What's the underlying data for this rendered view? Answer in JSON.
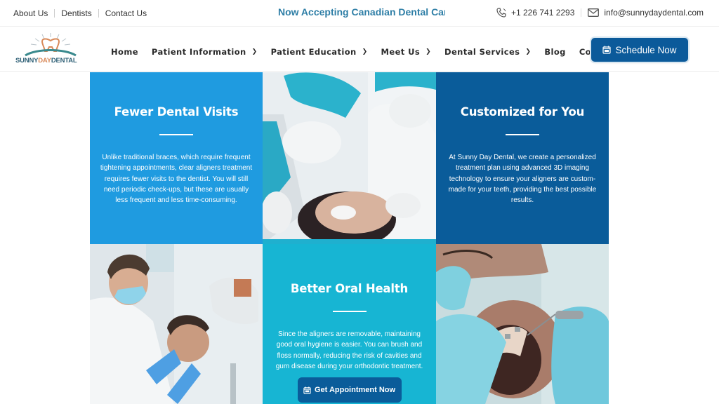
{
  "topbar": {
    "links": [
      "About Us",
      "Dentists",
      "Contact Us"
    ],
    "announcement": "Now Accepting Canadian Dental Care Plan",
    "phone": "+1 226 741 2293",
    "email": "info@sunnydaydental.com"
  },
  "brand": {
    "name_part1": "SUNNY",
    "name_part2": "DAY",
    "name_part3": "DENTAL",
    "accent": "#d98a5a",
    "primary": "#2f6076"
  },
  "nav": {
    "items": [
      {
        "label": "Home",
        "has_dropdown": false
      },
      {
        "label": "Patient Information",
        "has_dropdown": true
      },
      {
        "label": "Patient Education",
        "has_dropdown": true
      },
      {
        "label": "Meet Us",
        "has_dropdown": true
      },
      {
        "label": "Dental Services",
        "has_dropdown": true
      },
      {
        "label": "Blog",
        "has_dropdown": false
      },
      {
        "label": "Contact Us",
        "has_dropdown": false
      }
    ],
    "cta": "Schedule Now",
    "cta_icon": "calendar-icon"
  },
  "features": [
    {
      "title": "Fewer Dental Visits",
      "body": "Unlike traditional braces, which require frequent tightening appointments, clear aligners treatment requires fewer visits to the dentist. You will still need periodic check-ups, but these are usually less frequent and less time-consuming.",
      "color": "#1f9be0"
    },
    {
      "title": "Customized for You",
      "body": "At Sunny Day Dental, we create a personalized treatment plan using advanced 3D imaging technology to ensure your aligners are custom-made for your teeth, providing the best possible results.",
      "color": "#0a5c9a"
    },
    {
      "title": "Better Oral Health",
      "body": "Since the aligners are removable, maintaining good oral hygiene is easier. You can brush and floss normally, reducing the risk of cavities and gum disease during your orthodontic treatment.",
      "color": "#17b5d3",
      "button": "Get Appointment Now"
    }
  ],
  "images": [
    {
      "alt": "Dentists in teal caps treating a female patient"
    },
    {
      "alt": "Male dentist examining a smiling male patient"
    },
    {
      "alt": "Gloved hands working on teeth with braces"
    }
  ],
  "colors": {
    "announcement": "#2e7ea6",
    "button": "#0b5a9a"
  }
}
